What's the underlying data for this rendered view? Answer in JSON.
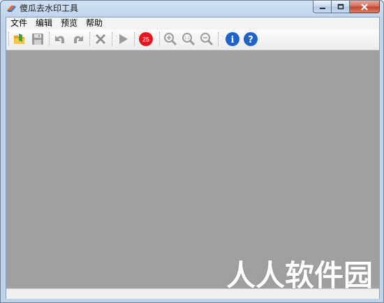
{
  "window": {
    "title": "傻瓜去水印工具",
    "app_icon": "eraser-icon"
  },
  "menu": [
    {
      "label": "文件"
    },
    {
      "label": "编辑"
    },
    {
      "label": "预览"
    },
    {
      "label": "帮助"
    }
  ],
  "toolbar": {
    "buttons": [
      {
        "name": "open-icon",
        "enabled": true
      },
      {
        "name": "save-icon",
        "enabled": false
      },
      {
        "name": "undo-icon",
        "enabled": false
      },
      {
        "name": "redo-icon",
        "enabled": false
      },
      {
        "name": "delete-icon",
        "enabled": false
      },
      {
        "name": "play-icon",
        "enabled": false
      },
      {
        "name": "brush-size-badge",
        "enabled": true
      },
      {
        "name": "zoom-in-icon",
        "enabled": false
      },
      {
        "name": "zoom-actual-icon",
        "enabled": false
      },
      {
        "name": "zoom-out-icon",
        "enabled": false
      },
      {
        "name": "info-icon",
        "enabled": true
      },
      {
        "name": "help-icon",
        "enabled": true
      }
    ],
    "brush_size": "25",
    "zoom_actual_label": "1:1",
    "info_glyph": "i",
    "help_glyph": "?"
  },
  "watermark": "人人软件园",
  "colors": {
    "canvas": "#a0a0a0",
    "badge": "#e8141b",
    "info_blue": "#1f63c8"
  }
}
